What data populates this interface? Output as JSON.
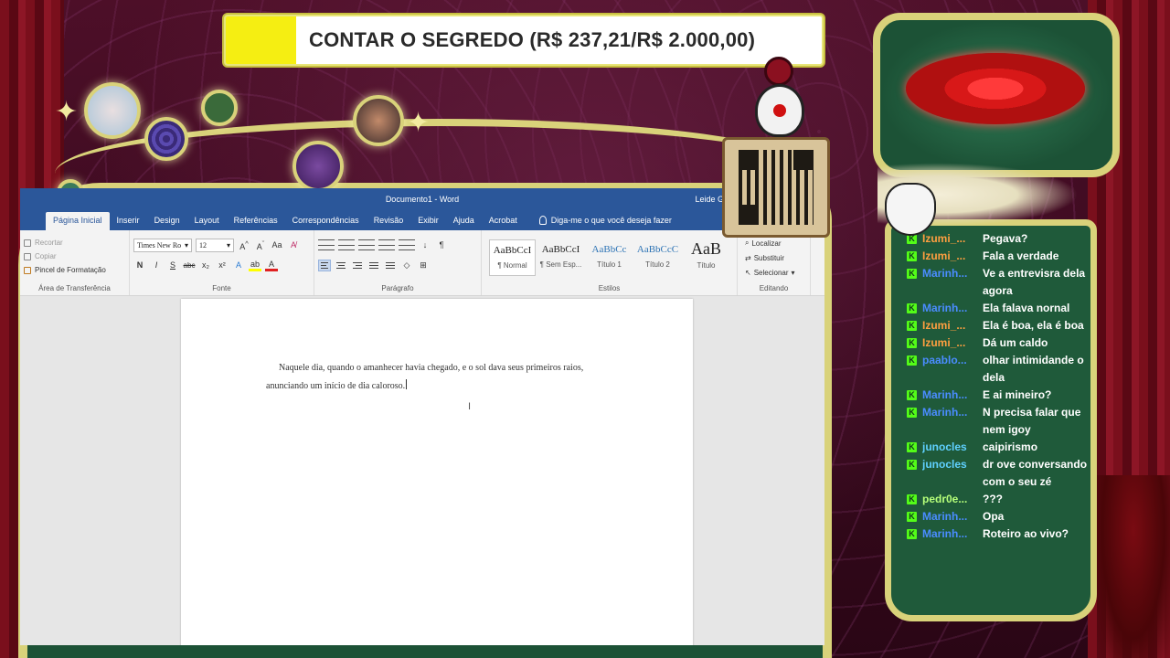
{
  "goal": {
    "text": "CONTAR O SEGREDO (R$ 237,21/R$ 2.000,00)",
    "progress": 0.1186,
    "fill_color": "#f5ee12"
  },
  "word": {
    "title": "Documento1 - Word",
    "user": "Leide Gon",
    "tabs": [
      "Página Inicial",
      "Inserir",
      "Design",
      "Layout",
      "Referências",
      "Correspondências",
      "Revisão",
      "Exibir",
      "Ajuda",
      "Acrobat"
    ],
    "tell_me": "Diga-me o que você deseja fazer",
    "clipboard": {
      "cut": "Recortar",
      "copy": "Copiar",
      "format_painter": "Pincel de Formatação",
      "label": "Área de Transferência"
    },
    "font": {
      "name": "Times New Ro",
      "size": "12",
      "label": "Fonte"
    },
    "paragraph": {
      "label": "Parágrafo"
    },
    "styles": {
      "label": "Estilos",
      "items": [
        {
          "sample": "AaBbCcI",
          "name": "¶ Normal"
        },
        {
          "sample": "AaBbCcI",
          "name": "¶ Sem Esp..."
        },
        {
          "sample": "AaBbCc",
          "name": "Título 1"
        },
        {
          "sample": "AaBbCcC",
          "name": "Título 2"
        },
        {
          "sample": "AaB",
          "name": "Título"
        }
      ]
    },
    "editing": {
      "find": "Localizar",
      "replace": "Substituir",
      "select": "Selecionar",
      "label": "Editando"
    },
    "document_text": "Naquele dia, quando o amanhecer havia chegado, e o sol dava seus primeiros raios, anunciando um início de dia caloroso."
  },
  "chat": {
    "badge": "K",
    "messages": [
      {
        "user": "Izumi_...",
        "color": "#ff9f40",
        "text": "Pegava?"
      },
      {
        "user": "Izumi_...",
        "color": "#ff9f40",
        "text": "Fala a verdade"
      },
      {
        "user": "Marinh...",
        "color": "#4a8cff",
        "text": "Ve a entrevisra dela agora"
      },
      {
        "user": "Marinh...",
        "color": "#4a8cff",
        "text": "Ela falava nornal"
      },
      {
        "user": "Izumi_...",
        "color": "#ff9f40",
        "text": "Ela é boa, ela é boa"
      },
      {
        "user": "Izumi_...",
        "color": "#ff9f40",
        "text": "Dá um caldo"
      },
      {
        "user": "paablo...",
        "color": "#4a8cff",
        "text": "olhar intimidande o dela"
      },
      {
        "user": "Marinh...",
        "color": "#4a8cff",
        "text": "E ai mineiro?"
      },
      {
        "user": "Marinh...",
        "color": "#4a8cff",
        "text": "N precisa falar que nem igoy"
      },
      {
        "user": "junocles",
        "color": "#5fd0ff",
        "text": "caipirismo"
      },
      {
        "user": "junocles",
        "color": "#5fd0ff",
        "text": "dr ove conversando com o seu zé"
      },
      {
        "user": "pedr0e...",
        "color": "#b6ff7a",
        "text": "???"
      },
      {
        "user": "Marinh...",
        "color": "#4a8cff",
        "text": "Opa"
      },
      {
        "user": "Marinh...",
        "color": "#4a8cff",
        "text": "Roteiro ao vivo?"
      }
    ]
  }
}
